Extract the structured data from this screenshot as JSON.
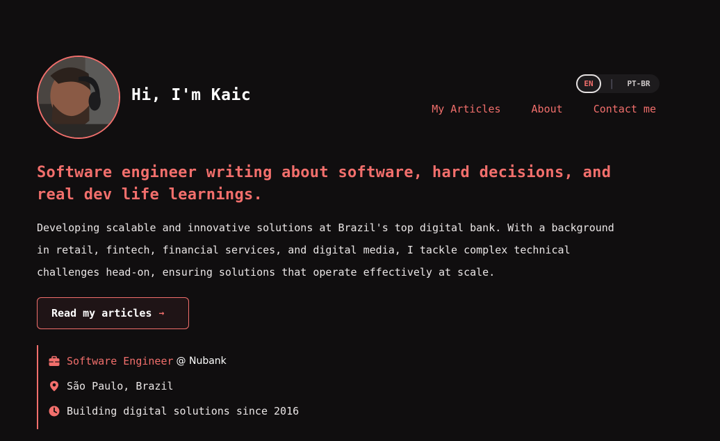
{
  "header": {
    "greeting": "Hi, I'm Kaic",
    "avatar_alt": "Profile photo",
    "language": {
      "active": "EN",
      "separator": "|",
      "other": "PT-BR"
    },
    "nav": [
      {
        "label": "My Articles"
      },
      {
        "label": "About"
      },
      {
        "label": "Contact me"
      }
    ]
  },
  "hero": {
    "headline_line1": "Software engineer writing about software, hard decisions, and",
    "headline_line2": "real dev life learnings.",
    "intro_line1": "Developing scalable and innovative solutions at Brazil's top digital bank. With a background",
    "intro_line2": "in retail, fintech, financial services, and digital media, I tackle complex technical",
    "intro_line3": "challenges head-on, ensuring solutions that operate effectively at scale.",
    "cta_label": "Read my articles",
    "cta_arrow": "→"
  },
  "info": {
    "role": "Software Engineer",
    "company": "@ Nubank",
    "location": "São Paulo, Brazil",
    "since": "Building digital solutions since 2016",
    "icons": [
      "briefcase-icon",
      "location-pin-icon",
      "clock-icon"
    ]
  },
  "colors": {
    "background": "#100e0f",
    "accent": "#f26f6c",
    "text": "#eae6e6"
  }
}
